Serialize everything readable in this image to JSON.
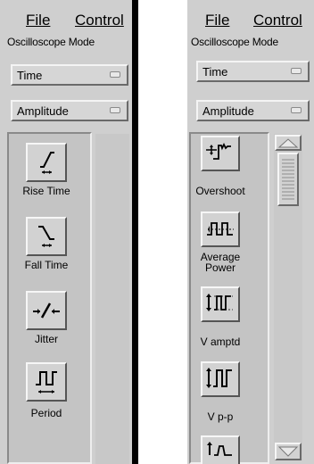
{
  "left_panel": {
    "menu": {
      "file": "File",
      "control": "Control"
    },
    "mode_label": "Oscilloscope Mode",
    "dropdown_time": "Time",
    "dropdown_amplitude": "Amplitude",
    "items": [
      {
        "label": "Rise Time",
        "icon": "rise-time-icon"
      },
      {
        "label": "Fall Time",
        "icon": "fall-time-icon"
      },
      {
        "label": "Jitter",
        "icon": "jitter-icon"
      },
      {
        "label": "Period",
        "icon": "period-icon"
      }
    ]
  },
  "right_panel": {
    "menu": {
      "file": "File",
      "control": "Control"
    },
    "mode_label": "Oscilloscope Mode",
    "dropdown_time": "Time",
    "dropdown_amplitude": "Amplitude",
    "items": [
      {
        "label": "Overshoot",
        "icon": "overshoot-icon"
      },
      {
        "label_line1": "Average",
        "label_line2": "Power",
        "icon": "average-power-icon"
      },
      {
        "label": "V amptd",
        "icon": "v-amplitude-icon"
      },
      {
        "label": "V p-p",
        "icon": "v-peak-to-peak-icon"
      },
      {
        "icon": "partial-measurement-icon"
      }
    ],
    "scrollbar": {
      "up": "scroll-up-arrow",
      "down": "scroll-down-arrow"
    }
  },
  "colors": {
    "panel": "#cfcfcf",
    "button_face": "#d2d2d2",
    "highlight": "#f6f6f6",
    "shadow": "#555555"
  }
}
